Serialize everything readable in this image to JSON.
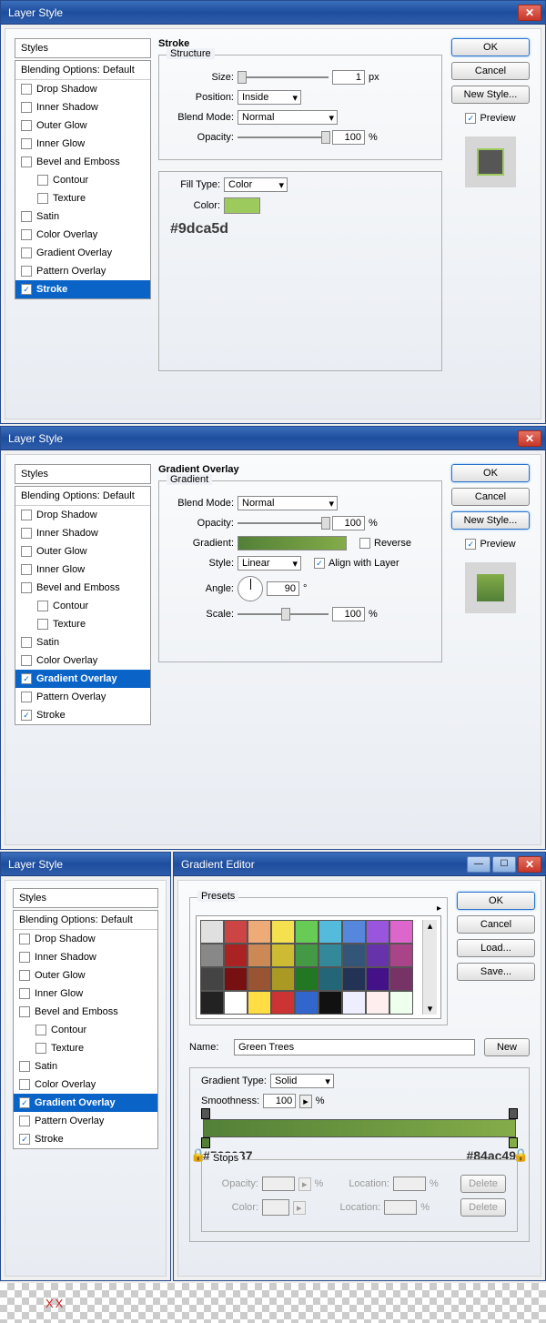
{
  "dialog1": {
    "title": "Layer Style",
    "styles_header": "Styles",
    "blending_opts": "Blending Options: Default",
    "items": [
      "Drop Shadow",
      "Inner Shadow",
      "Outer Glow",
      "Inner Glow",
      "Bevel and Emboss",
      "Contour",
      "Texture",
      "Satin",
      "Color Overlay",
      "Gradient Overlay",
      "Pattern Overlay",
      "Stroke"
    ],
    "panel_title": "Stroke",
    "structure_title": "Structure",
    "size_label": "Size:",
    "size_val": "1",
    "px": "px",
    "position_label": "Position:",
    "position_val": "Inside",
    "blend_label": "Blend Mode:",
    "blend_val": "Normal",
    "opacity_label": "Opacity:",
    "opacity_val": "100",
    "pct": "%",
    "filltype_label": "Fill Type:",
    "filltype_val": "Color",
    "color_label": "Color:",
    "color_hex": "#9dca5d",
    "ok": "OK",
    "cancel": "Cancel",
    "newstyle": "New Style...",
    "preview": "Preview"
  },
  "dialog2": {
    "title": "Layer Style",
    "panel_title": "Gradient Overlay",
    "gradient_title": "Gradient",
    "blend_label": "Blend Mode:",
    "blend_val": "Normal",
    "opacity_label": "Opacity:",
    "opacity_val": "100",
    "gradient_label": "Gradient:",
    "reverse": "Reverse",
    "style_label": "Style:",
    "style_val": "Linear",
    "align": "Align with Layer",
    "angle_label": "Angle:",
    "angle_val": "90",
    "deg": "°",
    "scale_label": "Scale:",
    "scale_val": "100",
    "ok": "OK",
    "cancel": "Cancel",
    "newstyle": "New Style...",
    "preview": "Preview"
  },
  "dialog3_left": {
    "title": "Layer Style",
    "styles_header": "Styles",
    "blending_opts": "Blending Options: Default"
  },
  "gradient_editor": {
    "title": "Gradient Editor",
    "presets": "Presets",
    "name_label": "Name:",
    "name_val": "Green Trees",
    "new_btn": "New",
    "grad_type_label": "Gradient Type:",
    "grad_type_val": "Solid",
    "smoothness_label": "Smoothness:",
    "smoothness_val": "100",
    "pct": "%",
    "left_color": "#528037",
    "right_color": "#84ac49",
    "stops_title": "Stops",
    "stops_opacity": "Opacity:",
    "stops_location": "Location:",
    "stops_color": "Color:",
    "delete": "Delete",
    "ok": "OK",
    "cancel": "Cancel",
    "load": "Load...",
    "save": "Save...",
    "preset_colors": [
      "#e0e0e0",
      "#c44",
      "#ea7",
      "#f5e050",
      "#6c5",
      "#5bd",
      "#58d",
      "#95d",
      "#d6c",
      "#888",
      "#a22",
      "#c85",
      "#cb3",
      "#494",
      "#389",
      "#357",
      "#63a",
      "#a48",
      "#444",
      "#711",
      "#953",
      "#a92",
      "#272",
      "#267",
      "#235",
      "#418",
      "#736",
      "#222",
      "#fff",
      "#fd4",
      "#c33",
      "#36c",
      "#111",
      "#eef",
      "#fee",
      "#efe"
    ]
  },
  "xx": "XX"
}
